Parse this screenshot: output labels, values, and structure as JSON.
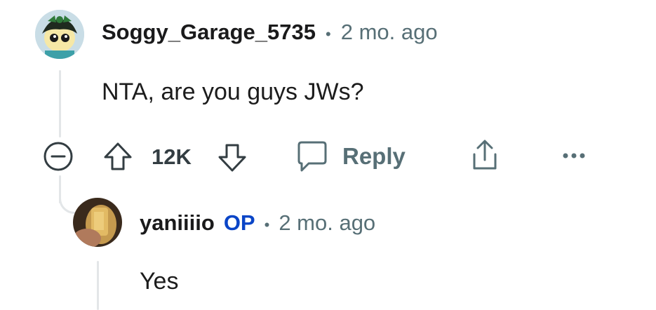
{
  "comment": {
    "username": "Soggy_Garage_5735",
    "separator": "•",
    "timestamp": "2 mo. ago",
    "text": "NTA, are you guys JWs?",
    "actions": {
      "collapse_icon": "minus-circle-icon",
      "upvote_icon": "arrow-up-icon",
      "vote_count": "12K",
      "downvote_icon": "arrow-down-icon",
      "reply_icon": "speech-bubble-icon",
      "reply_label": "Reply",
      "share_icon": "share-icon",
      "more_icon": "ellipsis-icon",
      "more_label": "..."
    }
  },
  "reply": {
    "username": "yaniiiio",
    "op_badge": "OP",
    "separator": "•",
    "timestamp": "2 mo. ago",
    "text": "Yes"
  },
  "colors": {
    "meta_gray": "#576f76",
    "op_blue": "#0a45c7",
    "thread_line": "#e3e6e8"
  }
}
